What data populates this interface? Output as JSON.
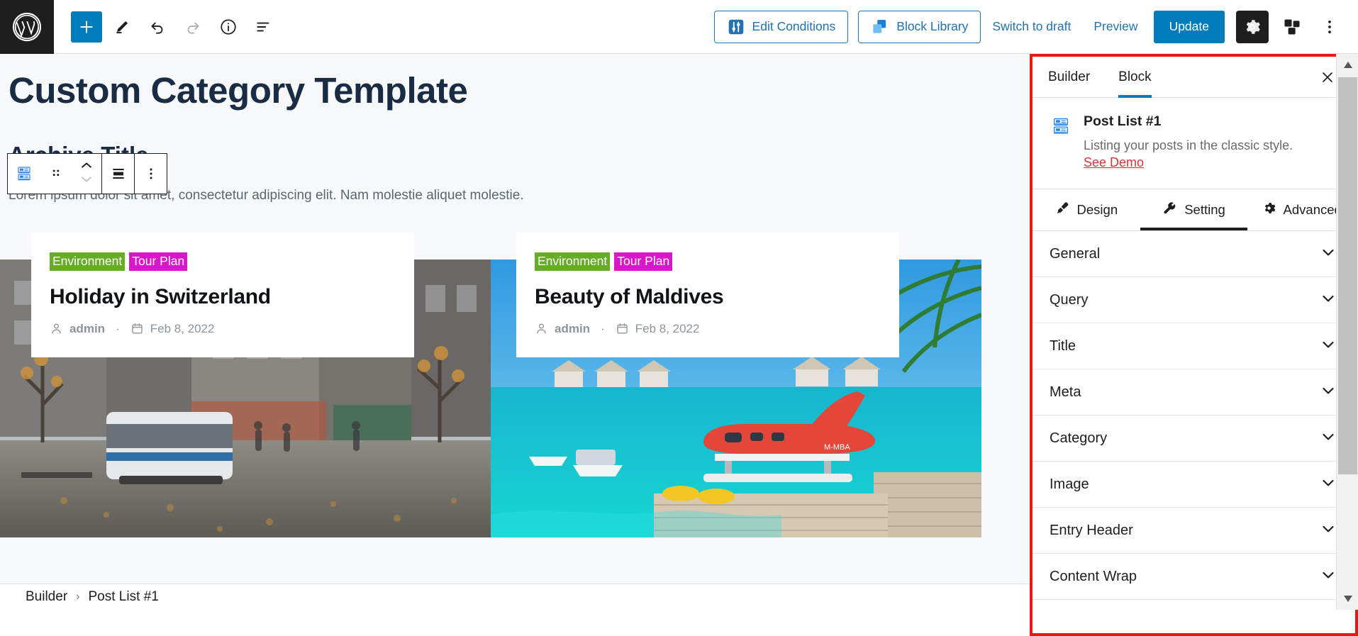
{
  "topbar": {
    "logo_icon": "wordpress-logo-icon",
    "add_block_label": "+",
    "tools": [
      {
        "name": "add-block-button",
        "icon": "plus-icon"
      },
      {
        "name": "tools-edit-button",
        "icon": "pencil-icon"
      },
      {
        "name": "undo-button",
        "icon": "undo-arrow-icon"
      },
      {
        "name": "redo-button",
        "icon": "redo-arrow-icon"
      },
      {
        "name": "details-button",
        "icon": "info-circle-icon"
      },
      {
        "name": "list-view-button",
        "icon": "list-view-icon"
      }
    ],
    "edit_conditions_label": "Edit Conditions",
    "block_library_label": "Block Library",
    "switch_to_draft_label": "Switch to draft",
    "preview_label": "Preview",
    "update_label": "Update",
    "settings_icon": "gear-icon",
    "blocks_icon": "stacked-squares-icon",
    "more_icon": "kebab-menu-icon",
    "accent_blue": "#007cba",
    "link_blue": "#2271b1"
  },
  "canvas": {
    "template_title": "Custom Category Template",
    "archive_title": "Archive Title",
    "paragraph": "Lorem ipsum dolor sit amet, consectetur adipiscing elit. Nam molestie aliquet molestie.",
    "block_toolbar": {
      "block_icon": "post-list-block-icon",
      "drag_icon": "drag-handle-icon",
      "move_up_icon": "chevron-up-icon",
      "move_down_icon": "chevron-down-icon",
      "align_icon": "align-center-icon",
      "options_icon": "kebab-menu-icon"
    },
    "posts": [
      {
        "categories": [
          {
            "label": "Environment",
            "color": "#66ac26"
          },
          {
            "label": "Tour Plan",
            "color": "#d818c8"
          }
        ],
        "title": "Holiday in Switzerland",
        "author": "admin",
        "separator": "·",
        "date": "Feb 8, 2022",
        "author_icon": "user-icon",
        "date_icon": "calendar-icon",
        "image_alt": "street-tram-autumn-photo"
      },
      {
        "categories": [
          {
            "label": "Environment",
            "color": "#66ac26"
          },
          {
            "label": "Tour Plan",
            "color": "#d818c8"
          }
        ],
        "title": "Beauty of Maldives",
        "author": "admin",
        "separator": "·",
        "date": "Feb 8, 2022",
        "author_icon": "user-icon",
        "date_icon": "calendar-icon",
        "image_alt": "maldives-seaplane-lagoon-photo"
      }
    ],
    "scrollbar": {
      "up_arrow_icon": "triangle-up-icon",
      "down_arrow_icon": "triangle-down-icon"
    }
  },
  "breadcrumb": {
    "root": "Builder",
    "chevron": "›",
    "current": "Post List #1"
  },
  "sidebar": {
    "highlight_color": "#e8190f",
    "tabs": [
      {
        "label": "Builder",
        "active": false
      },
      {
        "label": "Block",
        "active": true
      }
    ],
    "close_icon": "close-icon",
    "block": {
      "icon": "post-list-block-icon",
      "name": "Post List #1",
      "description": "Listing your posts in the classic style.",
      "demo_link": "See Demo",
      "demo_color": "#d63638"
    },
    "subtabs": [
      {
        "label": "Design",
        "icon": "brush-icon",
        "active": false
      },
      {
        "label": "Setting",
        "icon": "wrench-icon",
        "active": true
      },
      {
        "label": "Advanced",
        "icon": "gear-icon",
        "active": false
      }
    ],
    "sections": [
      {
        "label": "General",
        "expanded": false,
        "icon": "chevron-down-icon"
      },
      {
        "label": "Query",
        "expanded": false,
        "icon": "chevron-down-icon"
      },
      {
        "label": "Title",
        "expanded": false,
        "icon": "chevron-down-icon"
      },
      {
        "label": "Meta",
        "expanded": false,
        "icon": "chevron-down-icon"
      },
      {
        "label": "Category",
        "expanded": false,
        "icon": "chevron-down-icon"
      },
      {
        "label": "Image",
        "expanded": false,
        "icon": "chevron-down-icon"
      },
      {
        "label": "Entry Header",
        "expanded": false,
        "icon": "chevron-down-icon"
      },
      {
        "label": "Content Wrap",
        "expanded": false,
        "icon": "chevron-down-icon"
      }
    ]
  }
}
